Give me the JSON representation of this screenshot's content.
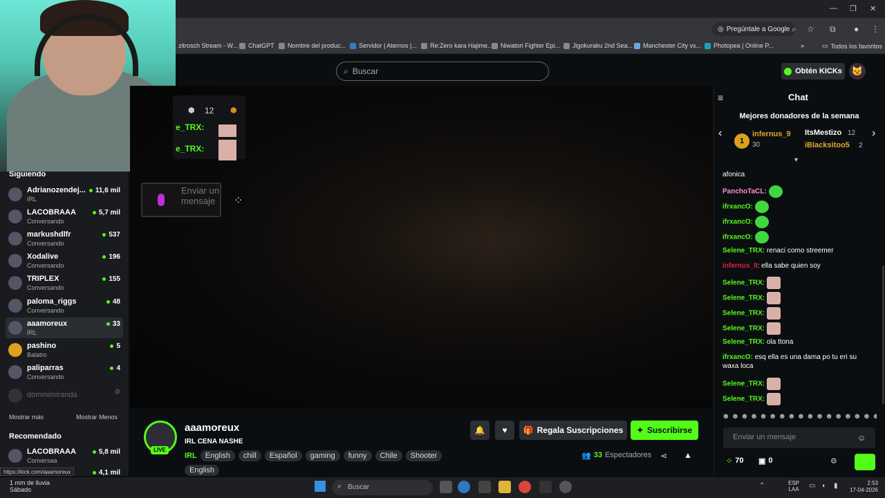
{
  "browser": {
    "ask_google": "Pregúntale a Google",
    "bookmarks": [
      {
        "label": "zitrosch Stream - W..."
      },
      {
        "label": "ChatGPT"
      },
      {
        "label": "Nombre del produc..."
      },
      {
        "label": "Servidor | Aternos |..."
      },
      {
        "label": "Re:Zero kara Hajime..."
      },
      {
        "label": "Niwatori Fighter Epi..."
      },
      {
        "label": "Jigokuraku 2nd Sea..."
      },
      {
        "label": "Manchester City vs..."
      },
      {
        "label": "Photopea | Online P..."
      }
    ],
    "all_favorites": "Todos los favoritos",
    "status_url": "https://kick.com/aaamoreux"
  },
  "header": {
    "search_placeholder": "Buscar",
    "kicks_button": "Obtén KICKs"
  },
  "sidebar": {
    "following_title": "Siguiendo",
    "channels": [
      {
        "name": "Adrianozendej...",
        "category": "IRL",
        "viewers": "11,6 mil"
      },
      {
        "name": "LACOBRAAA",
        "category": "Conversando",
        "viewers": "5,7 mil"
      },
      {
        "name": "markushdlfr",
        "category": "Conversando",
        "viewers": "537"
      },
      {
        "name": "Xodalive",
        "category": "Conversando",
        "viewers": "196"
      },
      {
        "name": "TRIPLEX",
        "category": "Conversando",
        "viewers": "155"
      },
      {
        "name": "paloma_riggs",
        "category": "Conversando",
        "viewers": "48"
      },
      {
        "name": "aaamoreux",
        "category": "IRL",
        "viewers": "33"
      },
      {
        "name": "pashino",
        "category": "Balatro",
        "viewers": "5"
      },
      {
        "name": "paliparras",
        "category": "Conversando",
        "viewers": "4"
      },
      {
        "name": "dommimiranda",
        "category": "",
        "viewers": ""
      }
    ],
    "show_more": "Mostrar más",
    "show_less": "Mostrar Menos",
    "recommended_title": "Recomendado",
    "recommended": [
      {
        "name": "LACOBRAAA",
        "category": "Conversaa",
        "viewers": "5,8 mil"
      },
      {
        "name": "",
        "category": "",
        "viewers": "4,1 mil"
      }
    ]
  },
  "video_overlay": {
    "count": "12",
    "names": [
      "e_TRX:",
      "e_TRX:"
    ],
    "send_message": "Enviar un mensaje"
  },
  "stream": {
    "streamer": "aaamoreux",
    "live": "LIVE",
    "title": "IRL CENA NASHE",
    "category": "IRL",
    "tags": [
      "English",
      "chill",
      "Español",
      "gaming",
      "funny",
      "Chile",
      "Shooter",
      "English"
    ],
    "gift_button": "Regala Suscripciones",
    "subscribe_button": "Suscribirse",
    "viewer_count": "33",
    "viewer_label": "Espectadores"
  },
  "chat": {
    "title": "Chat",
    "donors_title": "Mejores donadores de la semana",
    "donors": [
      {
        "rank": "1",
        "name": "infernus_9",
        "amount": "30"
      },
      {
        "name": "ItsMestizo",
        "amount": "12"
      },
      {
        "name": "iBlacksitoo5",
        "amount": "2"
      }
    ],
    "messages": [
      {
        "user": "",
        "text": "afonica"
      },
      {
        "user": "PanchoTaCL:",
        "text": ""
      },
      {
        "user": "ifrxancO:",
        "text": ""
      },
      {
        "user": "ifrxancO:",
        "text": ""
      },
      {
        "user": "ifrxancO:",
        "text": ""
      },
      {
        "user": "Selene_TRX:",
        "text": "renaci como streemer"
      },
      {
        "user": "infernus_9",
        "text": ": ella sabe quien soy"
      },
      {
        "user": "Selene_TRX:",
        "text": ""
      },
      {
        "user": "Selene_TRX:",
        "text": ""
      },
      {
        "user": "Selene_TRX:",
        "text": ""
      },
      {
        "user": "Selene_TRX:",
        "text": ""
      },
      {
        "user": "Selene_TRX:",
        "text": "ola ttona"
      },
      {
        "user": "ifrxancO:",
        "text": "esq ella es una dama po tu eri su waxa loca"
      },
      {
        "user": "Selene_TRX:",
        "text": ""
      },
      {
        "user": "Selene_TRX:",
        "text": ""
      }
    ],
    "input_placeholder": "Enviar un mensaje",
    "points": "70",
    "redeem": "0"
  },
  "taskbar": {
    "weather_temp": "1 mm de lluvia",
    "weather_day": "Sábado",
    "search": "Buscar",
    "lang1": "ESP",
    "lang2": "LAA",
    "time": "2:53",
    "date": "17-04-2026"
  },
  "colors": {
    "accent": "#53fc18",
    "background": "#0b0e11",
    "panel": "#191b1f"
  }
}
